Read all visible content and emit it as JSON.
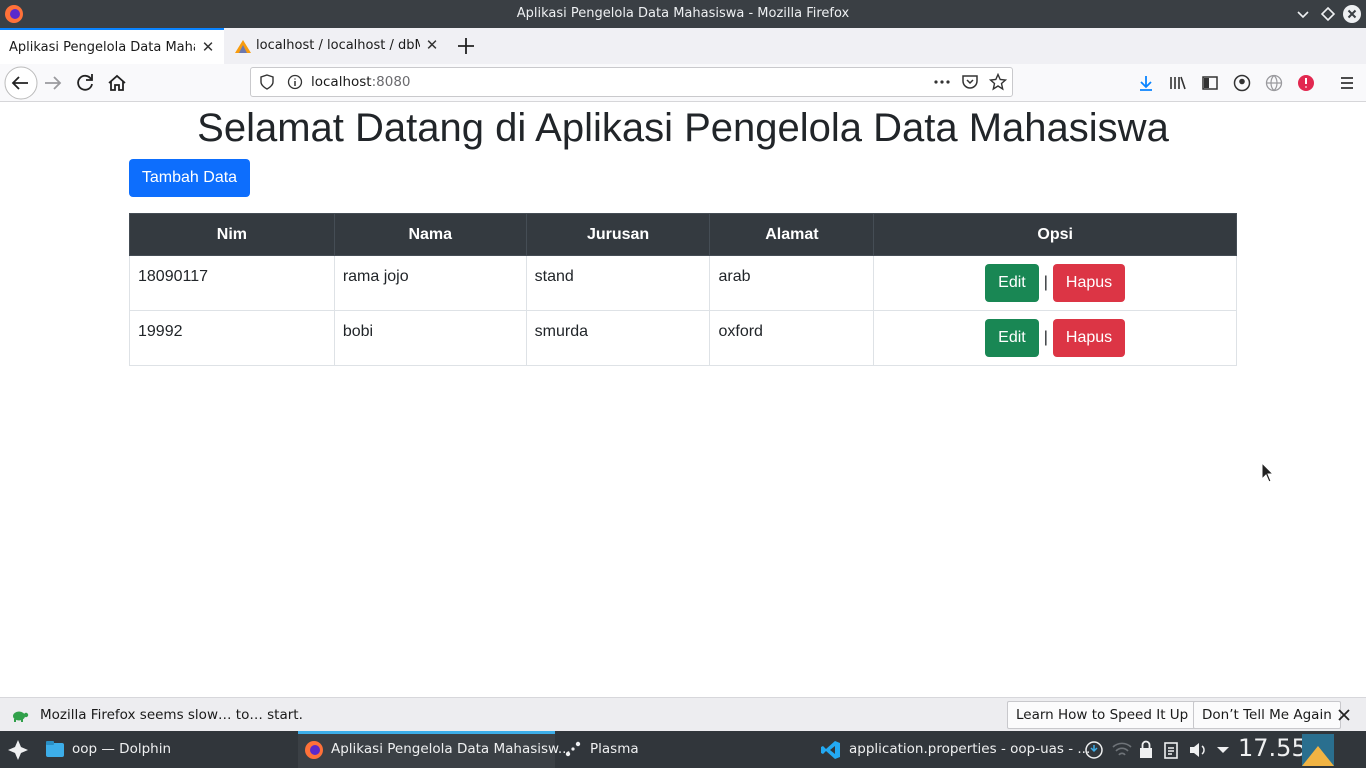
{
  "window": {
    "title": "Aplikasi Pengelola Data Mahasiswa - Mozilla Firefox"
  },
  "tabs": [
    {
      "label": "Aplikasi Pengelola Data Maha",
      "active": true
    },
    {
      "label": "localhost / localhost / dbM",
      "active": false
    }
  ],
  "navbar": {
    "url_host": "localhost",
    "url_port": ":8080"
  },
  "page": {
    "heading": "Selamat Datang di Aplikasi Pengelola Data Mahasiswa",
    "add_button": "Tambah Data",
    "table": {
      "headers": [
        "Nim",
        "Nama",
        "Jurusan",
        "Alamat",
        "Opsi"
      ],
      "rows": [
        {
          "nim": "18090117",
          "nama": "rama jojo",
          "jurusan": "stand",
          "alamat": "arab"
        },
        {
          "nim": "19992",
          "nama": "bobi",
          "jurusan": "smurda",
          "alamat": "oxford"
        }
      ],
      "edit_label": "Edit",
      "separator": "|",
      "delete_label": "Hapus"
    }
  },
  "notification": {
    "message": "Mozilla Firefox seems slow… to… start.",
    "learn_button": "Learn How to Speed It Up",
    "dismiss_button": "Don’t Tell Me Again"
  },
  "taskbar": {
    "tasks": [
      {
        "label": "oop — Dolphin"
      },
      {
        "label": "Aplikasi Pengelola Data Mahasisw..."
      },
      {
        "label": "Plasma"
      },
      {
        "label": "application.properties - oop-uas - ..."
      }
    ],
    "clock": "17.55"
  },
  "colors": {
    "primary": "#0d6efd",
    "success": "#198754",
    "danger": "#dc3545",
    "table_header": "#343a40"
  }
}
